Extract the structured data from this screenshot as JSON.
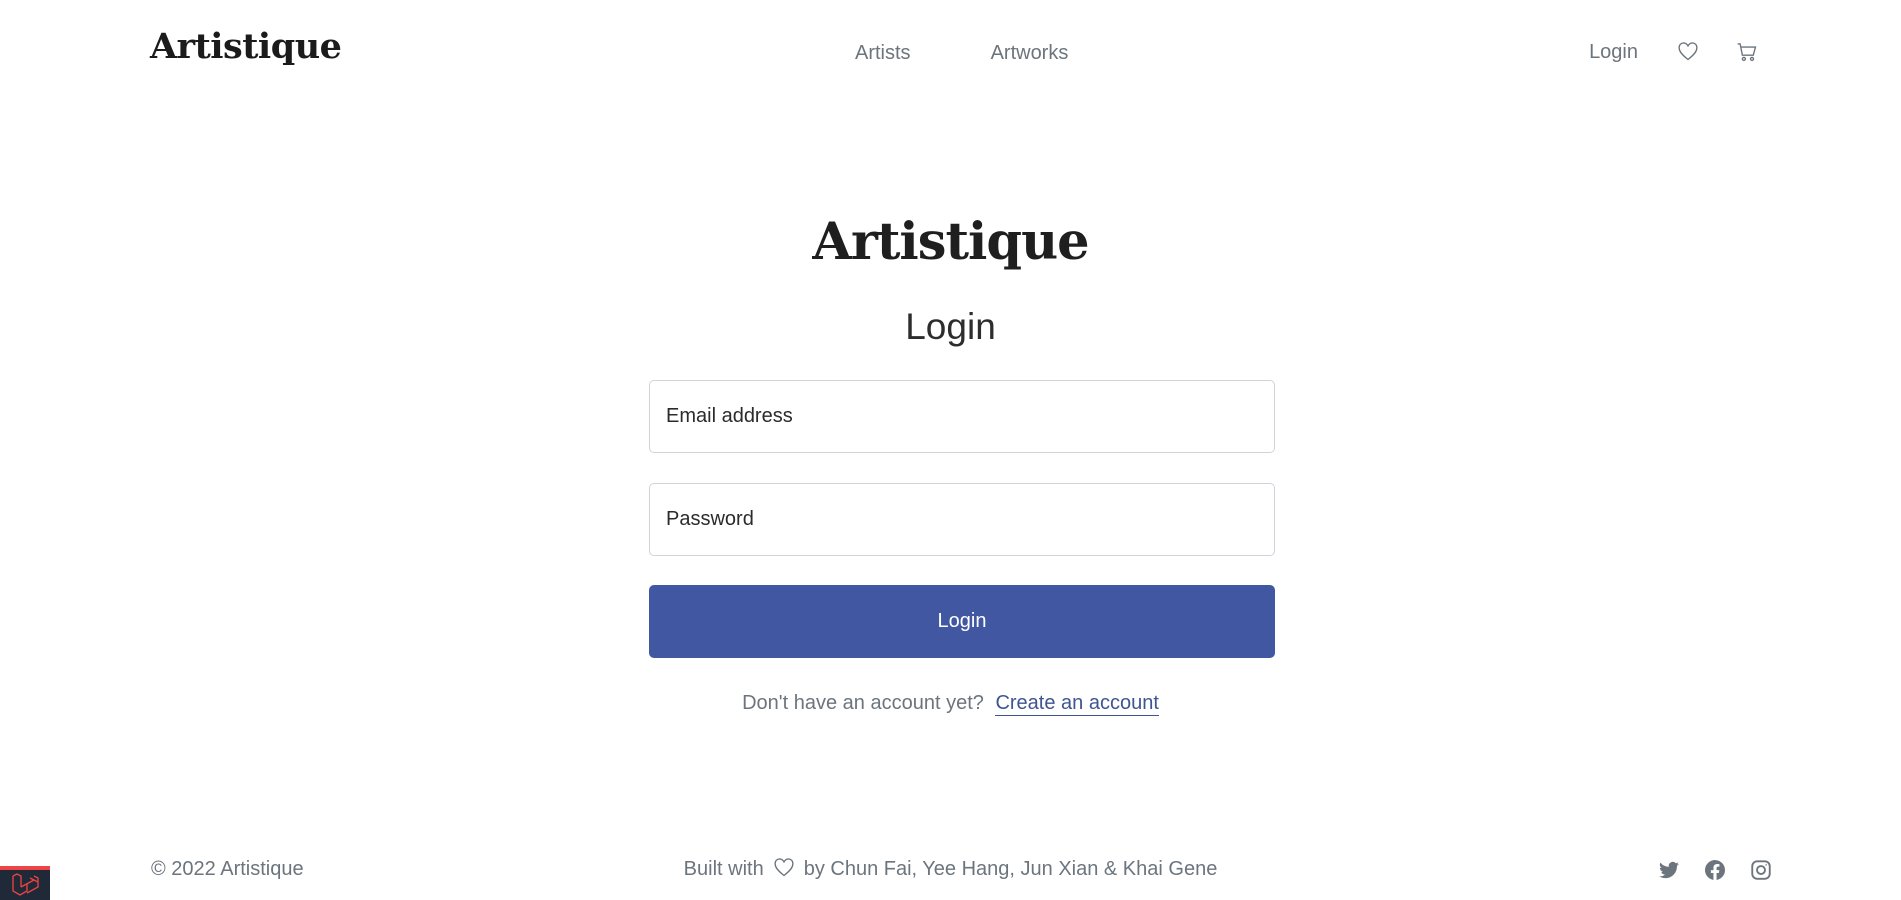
{
  "header": {
    "brand": "Artistique",
    "nav": [
      "Artists",
      "Artworks"
    ],
    "login_label": "Login",
    "icons": [
      "heart-icon",
      "cart-icon"
    ]
  },
  "login": {
    "brand": "Artistique",
    "title": "Login",
    "email_placeholder": "Email address",
    "password_placeholder": "Password",
    "submit_label": "Login",
    "signup_prompt": "Don't have an account yet?",
    "signup_link": "Create an account"
  },
  "footer": {
    "copyright": "© 2022 Artistique",
    "built_with": "Built with",
    "credits": "by Chun Fai, Yee Hang, Jun Xian & Khai Gene",
    "social_icons": [
      "twitter-icon",
      "facebook-icon",
      "instagram-icon"
    ]
  },
  "colors": {
    "primary": "#4157a2",
    "muted_text": "#6c757d",
    "link": "#3f5592",
    "badge_bg": "#1f2937",
    "badge_accent": "#ef4444"
  }
}
